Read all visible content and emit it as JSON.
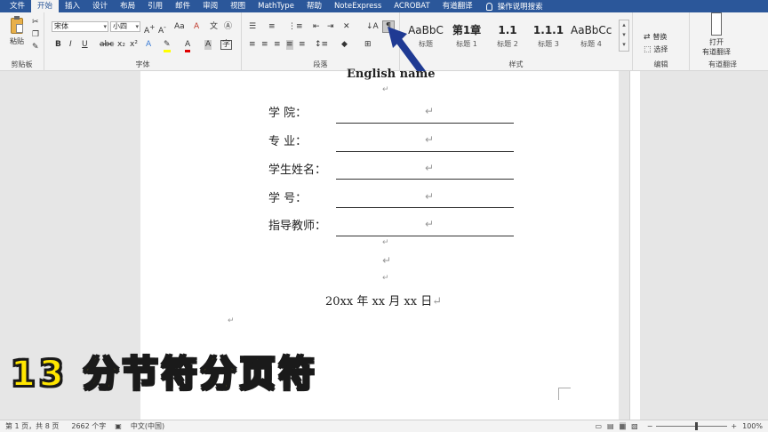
{
  "menubar": {
    "tabs": [
      "文件",
      "开始",
      "插入",
      "设计",
      "布局",
      "引用",
      "邮件",
      "审阅",
      "视图",
      "MathType",
      "帮助",
      "NoteExpress",
      "ACROBAT",
      "有道翻译"
    ],
    "active_tab": "开始",
    "search_label": "操作说明搜索"
  },
  "ribbon": {
    "clipboard": {
      "paste_label": "粘贴",
      "group_label": "剪贴板"
    },
    "font": {
      "font_name": "宋体",
      "font_size": "小四",
      "group_label": "字体"
    },
    "paragraph": {
      "group_label": "段落"
    },
    "styles": {
      "group_label": "样式",
      "items": [
        {
          "preview": "AaBbC",
          "name": "标题"
        },
        {
          "preview": "第1章",
          "name": "标题 1"
        },
        {
          "preview": "1.1",
          "name": "标题 2"
        },
        {
          "preview": "1.1.1",
          "name": "标题 3"
        },
        {
          "preview": "AaBbCc",
          "name": "标题 4"
        }
      ]
    },
    "editing": {
      "replace_label": "替换",
      "select_label": "选择",
      "group_label": "编辑"
    },
    "youdao": {
      "open_label": "打开",
      "translate_label": "有道翻译",
      "group_label": "有道翻译"
    }
  },
  "document": {
    "english_name": "English name",
    "fields": [
      {
        "label": "学    院："
      },
      {
        "label": "专    业："
      },
      {
        "label": "学生姓名："
      },
      {
        "label": "学    号："
      },
      {
        "label": "指导教师："
      }
    ],
    "date_line": "20xx  年  xx 月  xx 日",
    "para_mark": "↵"
  },
  "overlay": {
    "caption": "13 分节符分页符"
  },
  "statusbar": {
    "page_info": "第 1 页，共 8 页",
    "word_count": "2662 个字",
    "language": "中文(中国)",
    "zoom": "100%"
  },
  "colors": {
    "brand": "#2b579a",
    "overlay_text": "#ffe600",
    "arrow": "#1f3a93"
  }
}
